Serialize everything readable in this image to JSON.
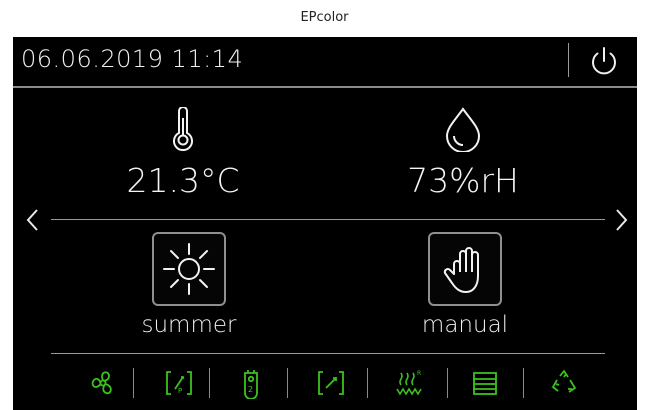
{
  "window": {
    "caption": "EPcolor"
  },
  "status_bar": {
    "datetime": "06.06.2019 11:14",
    "power_icon": "power-icon"
  },
  "measurements": {
    "temperature": {
      "icon": "thermometer-icon",
      "value": "21.3°C"
    },
    "humidity": {
      "icon": "water-drop-icon",
      "value": "73%rH"
    }
  },
  "navigation": {
    "left_icon": "chevron-left-icon",
    "right_icon": "chevron-right-icon"
  },
  "modes": {
    "season": {
      "icon": "sun-icon",
      "label": "summer"
    },
    "operation": {
      "icon": "hand-icon",
      "label": "manual"
    }
  },
  "bottom_bar": {
    "icons": [
      "fan-icon",
      "pressure-sensor-icon",
      "filter-stage-2-icon",
      "damper-icon",
      "heater-icon",
      "air-handling-unit-icon",
      "recirculation-icon"
    ]
  },
  "colors": {
    "background": "#000000",
    "foreground": "#f5f5f5",
    "divider": "#8a8a8a",
    "status_green": "#3cc21e"
  }
}
